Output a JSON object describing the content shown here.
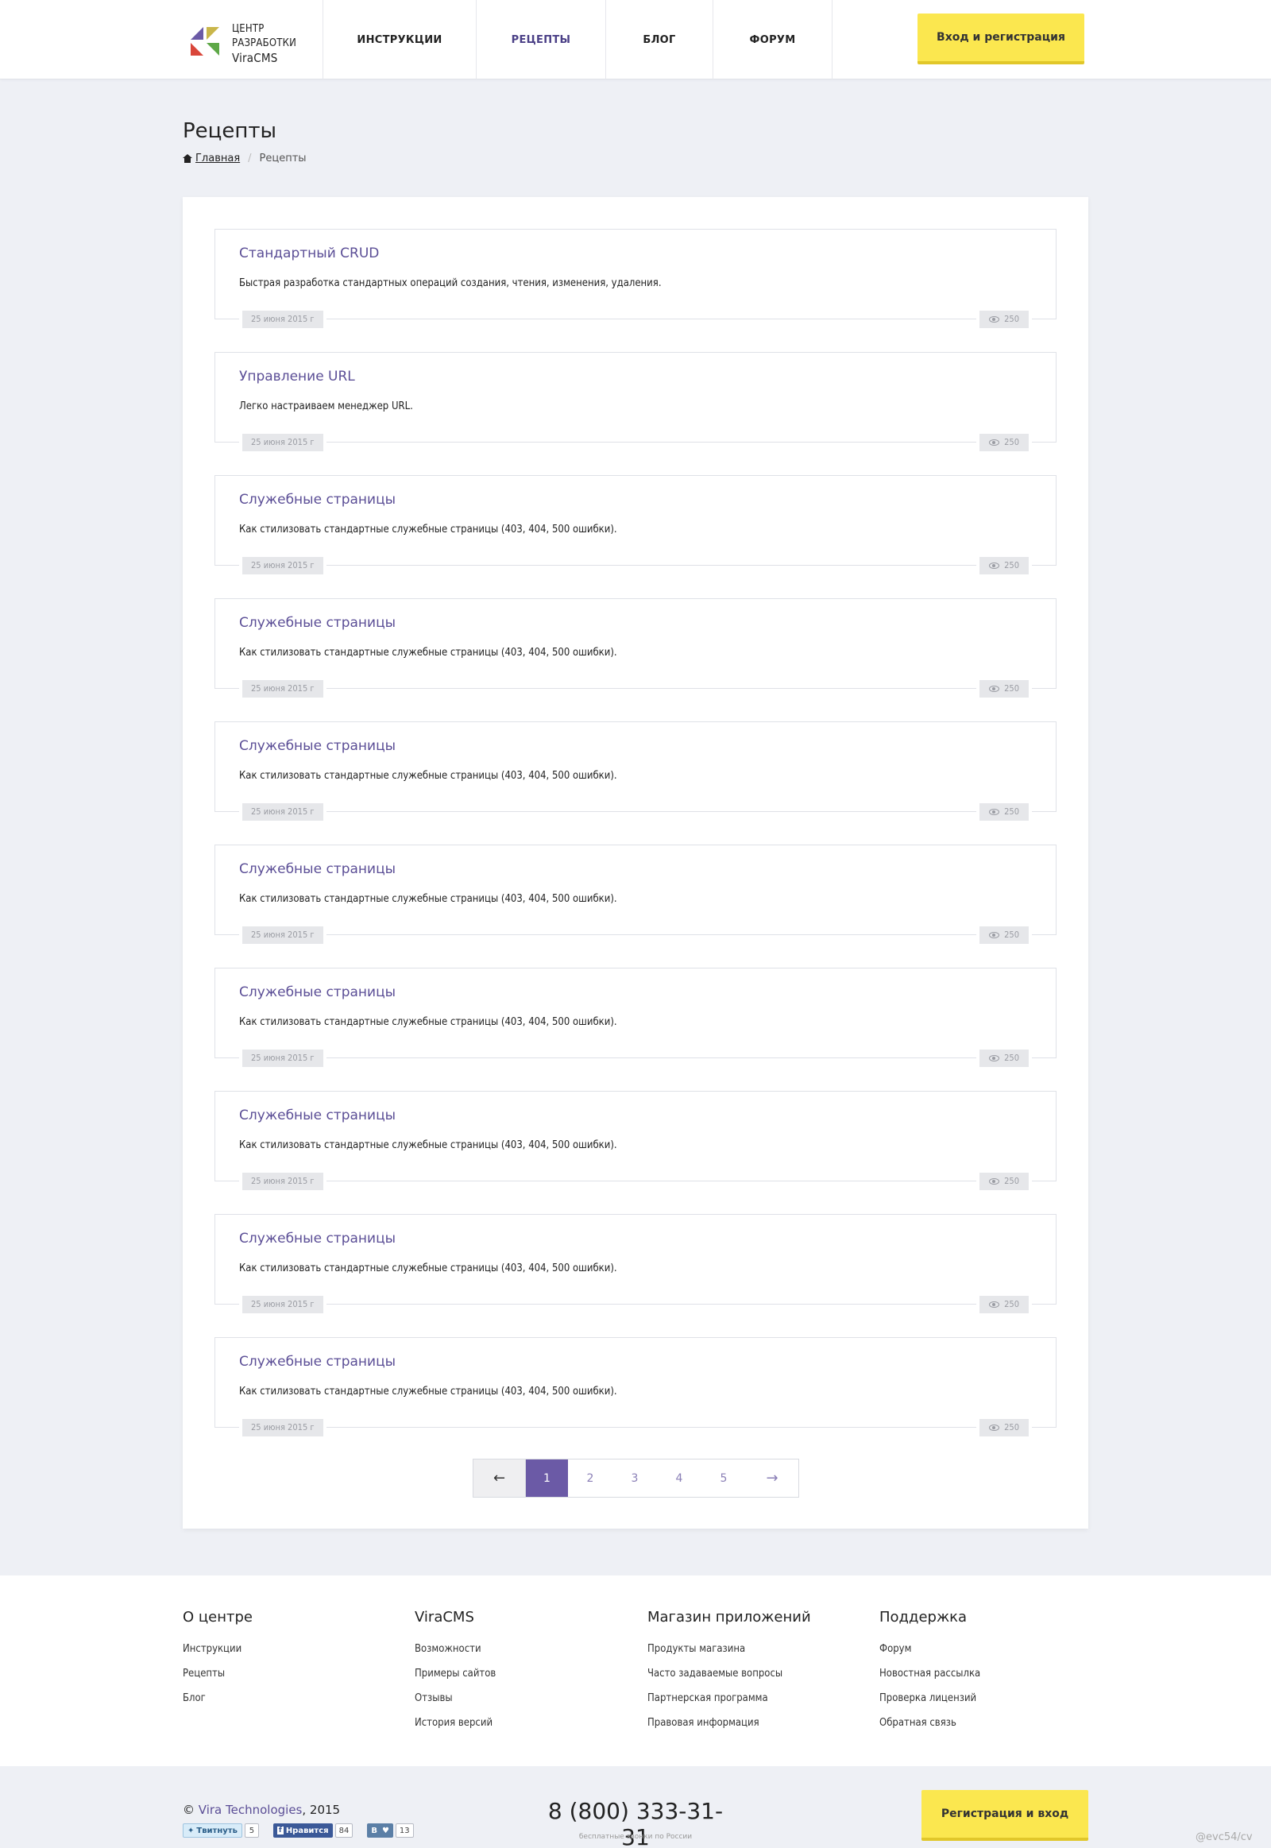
{
  "header": {
    "logo": {
      "line1": "ЦЕНТР",
      "line2": "РАЗРАБОТКИ",
      "brand": "ViraCMS"
    },
    "nav": [
      {
        "label": "ИНСТРУКЦИИ",
        "active": false
      },
      {
        "label": "РЕЦЕПТЫ",
        "active": true
      },
      {
        "label": "БЛОГ",
        "active": false
      },
      {
        "label": "ФОРУМ",
        "active": false
      }
    ],
    "login_label": "Вход и регистрация"
  },
  "page": {
    "title": "Рецепты",
    "breadcrumb": {
      "home": "Главная",
      "current": "Рецепты"
    }
  },
  "articles": [
    {
      "title": "Стандартный CRUD",
      "desc": "Быстрая разработка стандартных операций создания, чтения, изменения, удаления.",
      "date": "25 июня 2015 г",
      "views": "250"
    },
    {
      "title": "Управление URL",
      "desc": "Легко настраиваем менеджер URL.",
      "date": "25 июня 2015 г",
      "views": "250"
    },
    {
      "title": "Служебные страницы",
      "desc": "Как стилизовать стандартные служебные страницы (403, 404, 500 ошибки).",
      "date": "25 июня 2015 г",
      "views": "250"
    },
    {
      "title": "Служебные страницы",
      "desc": "Как стилизовать стандартные служебные страницы (403, 404, 500 ошибки).",
      "date": "25 июня 2015 г",
      "views": "250"
    },
    {
      "title": "Служебные страницы",
      "desc": "Как стилизовать стандартные служебные страницы (403, 404, 500 ошибки).",
      "date": "25 июня 2015 г",
      "views": "250"
    },
    {
      "title": "Служебные страницы",
      "desc": "Как стилизовать стандартные служебные страницы (403, 404, 500 ошибки).",
      "date": "25 июня 2015 г",
      "views": "250"
    },
    {
      "title": "Служебные страницы",
      "desc": "Как стилизовать стандартные служебные страницы (403, 404, 500 ошибки).",
      "date": "25 июня 2015 г",
      "views": "250"
    },
    {
      "title": "Служебные страницы",
      "desc": "Как стилизовать стандартные служебные страницы (403, 404, 500 ошибки).",
      "date": "25 июня 2015 г",
      "views": "250"
    },
    {
      "title": "Служебные страницы",
      "desc": "Как стилизовать стандартные служебные страницы (403, 404, 500 ошибки).",
      "date": "25 июня 2015 г",
      "views": "250"
    },
    {
      "title": "Служебные страницы",
      "desc": "Как стилизовать стандартные служебные страницы (403, 404, 500 ошибки).",
      "date": "25 июня 2015 г",
      "views": "250"
    }
  ],
  "pagination": {
    "prev": "←",
    "next": "→",
    "pages": [
      "1",
      "2",
      "3",
      "4",
      "5"
    ],
    "current": "1"
  },
  "footer": {
    "columns": [
      {
        "title": "О центре",
        "links": [
          "Инструкции",
          "Рецепты",
          "Блог"
        ]
      },
      {
        "title": "ViraCMS",
        "links": [
          "Возможности",
          "Примеры сайтов",
          "Отзывы",
          "История версий"
        ]
      },
      {
        "title": "Магазин приложений",
        "links": [
          "Продукты магазина",
          "Часто задаваемые вопросы",
          "Партнерская программа",
          "Правовая информация"
        ]
      },
      {
        "title": "Поддержка",
        "links": [
          "Форум",
          "Новостная рассылка",
          "Проверка лицензий",
          "Обратная связь"
        ]
      }
    ]
  },
  "bottom": {
    "copyright_symbol": "©",
    "company": "Vira Technologies",
    "year": ", 2015",
    "social": {
      "twitter": {
        "label": "Твитнуть",
        "count": "5"
      },
      "facebook": {
        "label": "Нравится",
        "count": "84"
      },
      "vk": {
        "label": "В",
        "count": "13"
      }
    },
    "phone": "8 (800) 333-31-31",
    "phone_note": "бесплатные звонки по России",
    "register_label": "Регистрация и вход",
    "credit": "@evc54/cv"
  },
  "colors": {
    "accent": "#6b5aa6",
    "link": "#5b4e96",
    "button_yellow": "#fbe74f",
    "background": "#eef0f5"
  }
}
